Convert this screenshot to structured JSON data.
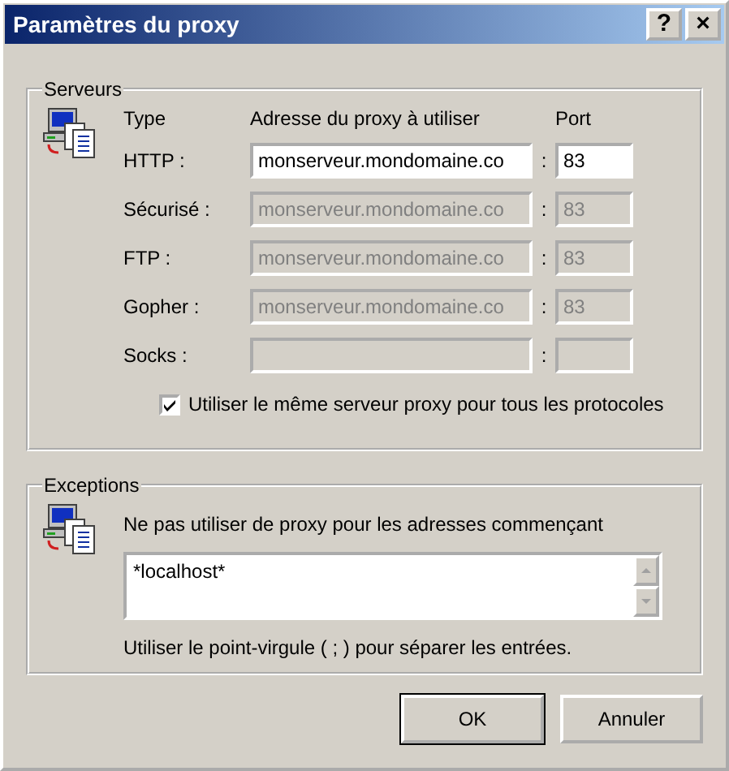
{
  "window": {
    "title": "Paramètres du proxy",
    "title_buttons": [
      "?",
      "×"
    ]
  },
  "servers": {
    "title": "Serveurs",
    "columns": [
      "Type",
      "Adresse du proxy à utiliser",
      "Port"
    ],
    "rows": [
      {
        "label": "HTTP :",
        "address": "monserveur.mondomaine.co",
        "port": "83",
        "disabled": false
      },
      {
        "label": "Sécurisé :",
        "address": "monserveur.mondomaine.co",
        "port": "83",
        "disabled": true
      },
      {
        "label": "FTP :",
        "address": "monserveur.mondomaine.co",
        "port": "83",
        "disabled": true
      },
      {
        "label": "Gopher :",
        "address": "monserveur.mondomaine.co",
        "port": "83",
        "disabled": true
      },
      {
        "label": "Socks :",
        "disabled": true
      }
    ],
    "separator": ":",
    "same_proxy": {
      "label": "Utiliser le même serveur proxy pour tous les protocoles",
      "checked": true
    }
  },
  "exceptions": {
    "title": "Exceptions",
    "prompt": "Ne pas utiliser de proxy pour les adresses commençant",
    "value": "*localhost*",
    "hint": "Utiliser le point-virgule ( ; ) pour séparer les entrées."
  },
  "buttons": [
    "OK",
    "Annuler"
  ]
}
